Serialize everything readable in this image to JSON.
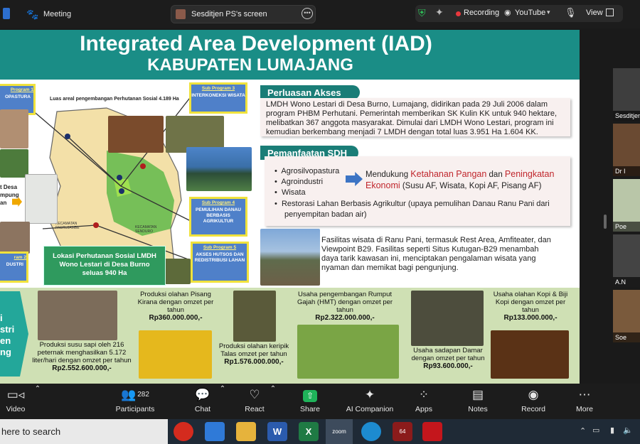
{
  "topbar": {
    "meeting_label": "Meeting",
    "screen_label": "Sesditjen PS's screen",
    "recording_label": "Recording",
    "youtube_label": "YouTube",
    "view_label": "View"
  },
  "slide": {
    "title": "Integrated Area Development (IAD)",
    "subtitle": "KABUPATEN LUMAJANG",
    "map_title": "Luas areal pengembangan Perhutanan Sosial 4.189 Ha",
    "map_district_1": "KECAMATAN PASRUJAMBE",
    "map_district_2": "KECAMATAN SENDURO",
    "left_cut_1": "Program 1",
    "left_cut_1b": "OPASTURA",
    "left_cut_2": "t Desa",
    "left_cut_3": "mpung",
    "left_cut_4": "an",
    "left_cut_5": "ram 2",
    "left_cut_6": "DUSTRI",
    "subprograms": [
      {
        "title": "Sub Program 3",
        "text": "INTERKONEKSI WISATA"
      },
      {
        "title": "Sub Program 4",
        "text": "PEMULIHAN DANAU BERBASIS AGRIKULTUR"
      },
      {
        "title": "Sub Program 5",
        "text": "AKSES HUTSOS DAN REDISTRIBUSI LAHAN"
      }
    ],
    "location_box": "Lokasi Perhutanan Sosial LMDH Wono Lestari di Desa Burno seluas 940 Ha",
    "perluasan_tag": "Perluasan Akses PS",
    "perluasan_text": "LMDH Wono Lestari di Desa Burno, Lumajang, didirikan pada 29 Juli 2006 dalam program PHBM Perhutani. Pemerintah memberikan SK Kulin KK untuk 940 hektare, melibatkan 367 anggota masyarakat. Dimulai dari LMDH Wono Lestari, program ini kemudian berkembang menjadi 7 LMDH dengan total luas 3.951 Ha 1.604 KK.",
    "pemanfaatan_tag": "Pemanfaatan SDH",
    "bullets": [
      "Agrosilvopastura",
      "Agroindustri",
      "Wisata",
      "Restorasi Lahan Berbasis Agrikultur (upaya pemulihan Danau Ranu Pani dari penyempitan badan air)"
    ],
    "mendukung_prefix": "Mendukung ",
    "mendukung_red_1": "Ketahanan Pangan",
    "mendukung_mid": " dan ",
    "mendukung_red_2": "Peningkatan Ekonomi",
    "mendukung_suffix": " (Susu AF, Wisata, Kopi AF, Pisang AF)",
    "fasilitas_text": "Fasilitas wisata di Ranu Pani, termasuk Rest Area, Amfiteater, dan Viewpoint B29. Fasilitas seperti Situs Kutugan-B29 menambah daya tarik kawasan ini, menciptakan pengalaman wisata yang nyaman dan memikat bagi pengunjung.",
    "arrow_lines": [
      "i",
      "stri",
      "en",
      "ng"
    ],
    "products": [
      {
        "text": "Produksi susu sapi oleh 216 peternak menghasilkan 5.172 liter/hari dengan omzet per tahun",
        "value": "Rp2.552.600.000,-"
      },
      {
        "text": "Produksi olahan Pisang Kirana dengan omzet per tahun",
        "value": "Rp360.000.000,-"
      },
      {
        "text": "Produksi olahan keripik Talas omzet per tahun",
        "value": "Rp1.576.000.000,-"
      },
      {
        "text": "Usaha pengembangan Rumput Gajah (HMT) dengan omzet per tahun",
        "value": "Rp2.322.000.000,-"
      },
      {
        "text": "Usaha sadapan Damar dengan omzet per tahun",
        "value": "Rp93.600.000,-"
      },
      {
        "text": "Usaha olahan Kopi & Biji Kopi dengan omzet per tahun",
        "value": "Rp133.000.000,-"
      }
    ]
  },
  "participants": [
    {
      "name": "Sesditjen"
    },
    {
      "name": "Dr I"
    },
    {
      "name": "Poe"
    },
    {
      "name": "A.N"
    },
    {
      "name": "Soe"
    }
  ],
  "toolbar": {
    "video": "Video",
    "participants": "Participants",
    "participant_count": "282",
    "chat": "Chat",
    "react": "React",
    "share": "Share",
    "ai": "AI Companion",
    "apps": "Apps",
    "notes": "Notes",
    "record": "Record",
    "more": "More"
  },
  "taskbar": {
    "search_placeholder": "here to search",
    "badge": "64"
  },
  "colors": {
    "header_teal": "#1a8d86",
    "tag_teal": "#1a7d77",
    "accent_red": "#c0262c",
    "share_green": "#1fb35a"
  }
}
